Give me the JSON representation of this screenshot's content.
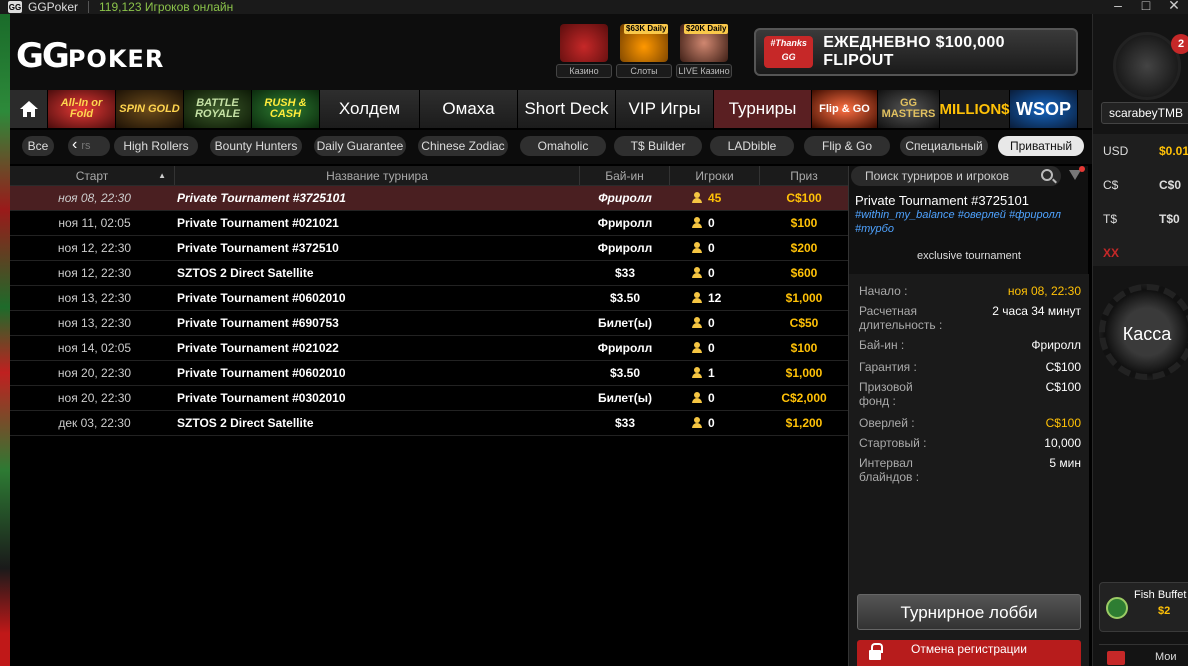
{
  "window": {
    "app_title": "GGPoker",
    "online": "119,123 Игроков онлайн",
    "logo_short": "GG"
  },
  "header": {
    "brand_gg": "GG",
    "brand_poker": "POKER",
    "shortcuts": [
      {
        "tag": "",
        "label": "Казино"
      },
      {
        "tag": "$63K Daily",
        "label": "Слоты"
      },
      {
        "tag": "$20K Daily",
        "label": "LIVE Казино"
      }
    ],
    "promo_badge": "#Thanks GG",
    "promo_text": "ЕЖЕДНЕВНО $100,000 FLIPOUT"
  },
  "nav": {
    "promos_left": [
      "All-In or Fold",
      "SPIN GOLD",
      "BATTLE ROYALE",
      "RUSH & CASH"
    ],
    "tabs": [
      "Холдем",
      "Омаха",
      "Short Deck",
      "VIP Игры",
      "Турниры"
    ],
    "active_tab": "Турниры",
    "promos_right": [
      "Flip & GO",
      "GG MASTERS",
      "MILLION$",
      "WSOP"
    ]
  },
  "filters": {
    "chips": [
      "Все",
      "High Rollers",
      "Bounty Hunters",
      "Daily Guarantee",
      "Chinese Zodiac",
      "Omaholic",
      "T$ Builder",
      "LADbible",
      "Flip & Go",
      "Специальный",
      "Приватный"
    ],
    "back_glyph": "‹",
    "back_partial": "rs",
    "active": "Приватный"
  },
  "table": {
    "columns": [
      "Старт",
      "Название турнира",
      "Бай-ин",
      "Игроки",
      "Приз"
    ],
    "rows": [
      {
        "start": "ноя 08, 22:30",
        "name": "Private Tournament #3725101",
        "buyin": "Фриролл",
        "players": "45",
        "prize": "C$100",
        "selected": true
      },
      {
        "start": "ноя 11, 02:05",
        "name": "Private Tournament #021021",
        "buyin": "Фриролл",
        "players": "0",
        "prize": "$100"
      },
      {
        "start": "ноя 12, 22:30",
        "name": "Private Tournament #372510",
        "buyin": "Фриролл",
        "players": "0",
        "prize": "$200"
      },
      {
        "start": "ноя 12, 22:30",
        "name": "SZTOS 2 Direct Satellite",
        "buyin": "$33",
        "players": "0",
        "prize": "$600"
      },
      {
        "start": "ноя 13, 22:30",
        "name": "Private Tournament #0602010",
        "buyin": "$3.50",
        "players": "12",
        "prize": "$1,000"
      },
      {
        "start": "ноя 13, 22:30",
        "name": "Private Tournament #690753",
        "buyin": "Билет(ы)",
        "players": "0",
        "prize": "C$50"
      },
      {
        "start": "ноя 14, 02:05",
        "name": "Private Tournament #021022",
        "buyin": "Фриролл",
        "players": "0",
        "prize": "$100"
      },
      {
        "start": "ноя 20, 22:30",
        "name": "Private Tournament #0602010",
        "buyin": "$3.50",
        "players": "1",
        "prize": "$1,000"
      },
      {
        "start": "ноя 20, 22:30",
        "name": "Private Tournament #0302010",
        "buyin": "Билет(ы)",
        "players": "0",
        "prize": "C$2,000"
      },
      {
        "start": "дек 03, 22:30",
        "name": "SZTOS 2 Direct Satellite",
        "buyin": "$33",
        "players": "0",
        "prize": "$1,200"
      }
    ]
  },
  "detail": {
    "search_placeholder": "Поиск турниров и игроков",
    "title": "Private Tournament #3725101",
    "tags": "#within_my_balance #оверлей #фриролл #турбо",
    "exclusive": "exclusive tournament",
    "info": [
      {
        "label": "Начало :",
        "value": "ноя 08, 22:30",
        "gold": true
      },
      {
        "label": "Расчетная длительность :",
        "value": "2 часа 34 минут"
      },
      {
        "label": "Бай-ин :",
        "value": "Фриролл"
      },
      {
        "label": "Гарантия :",
        "value": "C$100"
      },
      {
        "label": "Призовой фонд :",
        "value": "C$100"
      },
      {
        "label": "Оверлей :",
        "value": "C$100",
        "gold": true
      },
      {
        "label": "Стартовый :",
        "value": "10,000"
      },
      {
        "label": "Интервал блайндов :",
        "value": "5 мин"
      }
    ],
    "lobby_button": "Турнирное лобби",
    "cancel_button": "Отмена регистрации"
  },
  "sidebar": {
    "badge": "2",
    "username": "scarabeyTMB",
    "balances": [
      {
        "cur": "USD",
        "val": "$0.01"
      },
      {
        "cur": "C$",
        "val": "C$0"
      },
      {
        "cur": "T$",
        "val": "T$0"
      }
    ],
    "bal_extra": "XX",
    "kassa": "Касса",
    "fish_name": "Fish Buffet",
    "fish_value": "$2",
    "more": "Мои"
  }
}
